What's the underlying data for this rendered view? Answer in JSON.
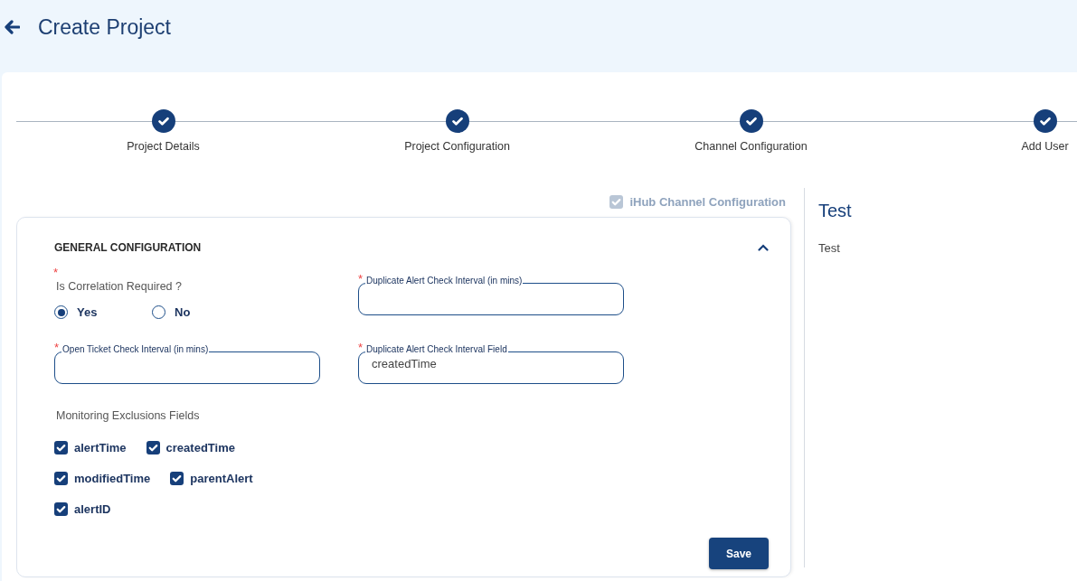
{
  "header": {
    "title": "Create Project"
  },
  "steps": [
    {
      "label": "Project Details",
      "completed": true
    },
    {
      "label": "Project Configuration",
      "completed": true
    },
    {
      "label": "Channel Configuration",
      "completed": true
    },
    {
      "label": "Add User",
      "completed": true
    }
  ],
  "channel_option": {
    "label": "iHub Channel Configuration",
    "checked": true,
    "disabled": true
  },
  "section": {
    "title": "GENERAL CONFIGURATION",
    "expanded": true,
    "form_items": [
      {
        "kind": "radio",
        "label": "Is Correlation Required ?",
        "required_mark": "*",
        "options": [
          {
            "label": "Yes",
            "selected": true
          },
          {
            "label": "No",
            "selected": false
          }
        ]
      },
      {
        "kind": "field",
        "label": "Duplicate Alert Check Interval (in mins)",
        "required_mark": "*",
        "value": ""
      },
      {
        "kind": "field",
        "label": "Open Ticket Check Interval (in mins)",
        "required_mark": "*",
        "value": ""
      },
      {
        "kind": "field",
        "label": "Duplicate Alert Check Interval Field",
        "required_mark": "*",
        "value": "createdTime"
      }
    ],
    "exclusions": {
      "label": "Monitoring Exclusions Fields",
      "rows": [
        [
          {
            "label": "alertTime",
            "checked": true
          },
          {
            "label": "createdTime",
            "checked": true
          }
        ],
        [
          {
            "label": "modifiedTime",
            "checked": true
          },
          {
            "label": "parentAlert",
            "checked": true
          }
        ],
        [
          {
            "label": "alertID",
            "checked": true
          }
        ]
      ]
    },
    "save_button": "Save"
  },
  "side_panel": {
    "title": "Test",
    "text": "Test"
  }
}
